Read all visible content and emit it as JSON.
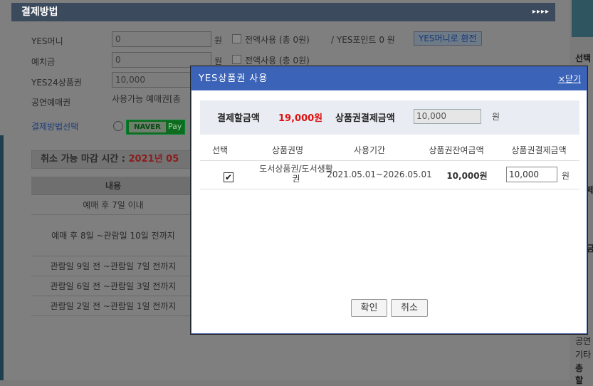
{
  "bg": {
    "header_title": "결제방법",
    "header_arrows": "▸▸▸▸",
    "rows": [
      {
        "label": "YES머니",
        "value": "0",
        "unit": "원",
        "check_label": "전액사용 (총 0원)"
      },
      {
        "label": "예치금",
        "value": "0",
        "unit": "원",
        "check_label": "전액사용 (총 0원)"
      },
      {
        "label": "YES24상품권",
        "value": "10,000"
      },
      {
        "label": "공연예매권",
        "text": "사용가능 예매권[총"
      }
    ],
    "yes_point_text": "/ YES포인트 0 원",
    "convert_button": "YES머니로 환전",
    "pay_method_label": "결제방법선택",
    "naver_label": "NAVER",
    "pay_label": "Pay",
    "cancel_title": "취소 가능 마감 시간 :",
    "cancel_date": "2021년 05",
    "table_header": "내용",
    "table_rows": [
      "예매 후 7일 이내",
      "예매 후 8일 ~관람일 10일 전까지",
      "관람일 9일 전 ~관람일 7일 전까지",
      "관람일 6일 전 ~관람일 3일 전까지",
      "관람일 2일 전 ~관람일 1일 전까지"
    ],
    "right_texts": [
      "선택",
      "제",
      "금",
      "공연",
      "기타",
      "총 할"
    ]
  },
  "dialog": {
    "title": "YES상품권 사용",
    "close_label": "닫기",
    "close_symbol": "×",
    "pay_amount_label": "결제할금액",
    "pay_amount_value": "19,000원",
    "gift_pay_label": "상품권결제금액",
    "gift_pay_value": "10,000",
    "unit": "원",
    "columns": [
      "선택",
      "상품권명",
      "사용기간",
      "상품권잔여금액",
      "상품권결제금액"
    ],
    "row": {
      "checked": true,
      "name": "도서상품권/도서생활권",
      "period": "2021.05.01~2026.05.01",
      "balance": "10,000원",
      "pay_value": "10,000",
      "unit": "원"
    },
    "confirm_button": "확인",
    "cancel_button": "취소"
  }
}
